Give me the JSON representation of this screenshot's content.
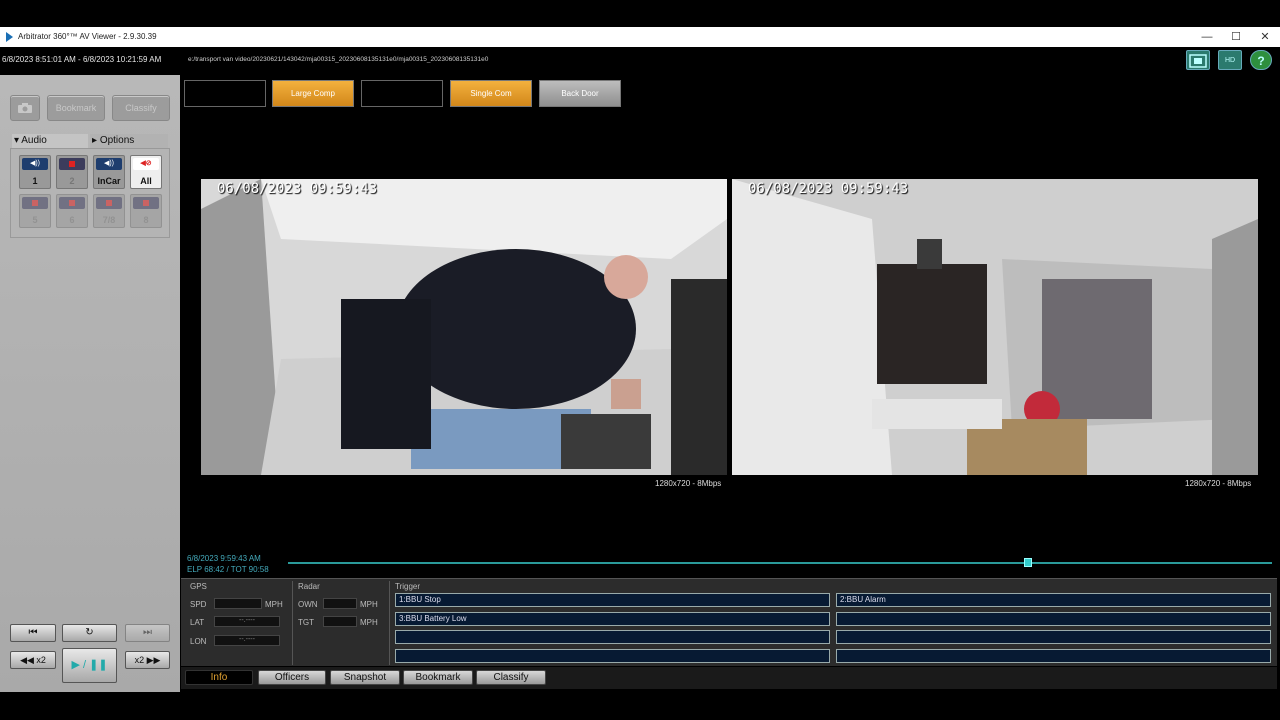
{
  "window": {
    "title": "Arbitrator 360°™ AV Viewer - 2.9.30.39",
    "minimize": "—",
    "maximize": "☐",
    "close": "✕"
  },
  "header": {
    "date_range": "6/8/2023 8:51:01 AM - 6/8/2023 10:21:59 AM",
    "file_path": "e:/transport van video/20230621/143042/mja00315_20230608135131e0/mja00315_20230608135131e0",
    "icons": [
      "film-icon",
      "hd-icon",
      "help-icon"
    ],
    "hd_label": "HD",
    "help_label": "?"
  },
  "left_panel": {
    "snapshot_icon": "camera-icon",
    "bookmark_label": "Bookmark",
    "classify_label": "Classify",
    "audio_label": "Audio",
    "options_label": "Options",
    "channels_row1": [
      {
        "label": "1",
        "state": "on"
      },
      {
        "label": "2",
        "state": "muted"
      },
      {
        "label": "InCar",
        "state": "on"
      },
      {
        "label": "All",
        "state": "mute-all"
      }
    ],
    "channels_row2": [
      {
        "label": "5",
        "state": "muted"
      },
      {
        "label": "6",
        "state": "muted"
      },
      {
        "label": "7/8",
        "state": "muted"
      },
      {
        "label": "8",
        "state": "muted"
      }
    ],
    "transport": {
      "start": "⏮",
      "loop": "↻",
      "end": "⏭",
      "rewind": "◀◀ x2",
      "play_pause": "▶ / ❚❚",
      "forward": "x2 ▶▶"
    }
  },
  "camera_buttons": [
    {
      "label": "",
      "style": "black"
    },
    {
      "label": "Large Comp",
      "style": "orange"
    },
    {
      "label": "",
      "style": "black"
    },
    {
      "label": "Single Com",
      "style": "orange"
    },
    {
      "label": "Back Door",
      "style": "gray"
    }
  ],
  "videos": [
    {
      "timestamp": "06/08/2023 09:59:43",
      "resolution": "1280x720 - 8Mbps"
    },
    {
      "timestamp": "06/08/2023 09:59:43",
      "resolution": "1280x720 - 8Mbps"
    }
  ],
  "timeline": {
    "current_time": "6/8/2023 9:59:43 AM",
    "elapsed": "ELP 68:42 / TOT 90:58",
    "position": 0.75
  },
  "info": {
    "gps_label": "GPS",
    "spd_label": "SPD",
    "lat_label": "LAT",
    "lon_label": "LON",
    "mph_label": "MPH",
    "lat_value": "--.----",
    "lon_value": "--.----",
    "radar_label": "Radar",
    "own_label": "OWN",
    "tgt_label": "TGT",
    "trigger_label": "Trigger",
    "triggers": [
      "1:BBU Stop",
      "2:BBU Alarm",
      "3:BBU Battery Low",
      "",
      "",
      "",
      "",
      ""
    ]
  },
  "tabs": [
    "Info",
    "Officers",
    "Snapshot",
    "Bookmark",
    "Classify"
  ],
  "colors": {
    "accent_orange": "#e0a030",
    "teal": "#2a9a9a",
    "trigger_bg": "#071a33"
  }
}
